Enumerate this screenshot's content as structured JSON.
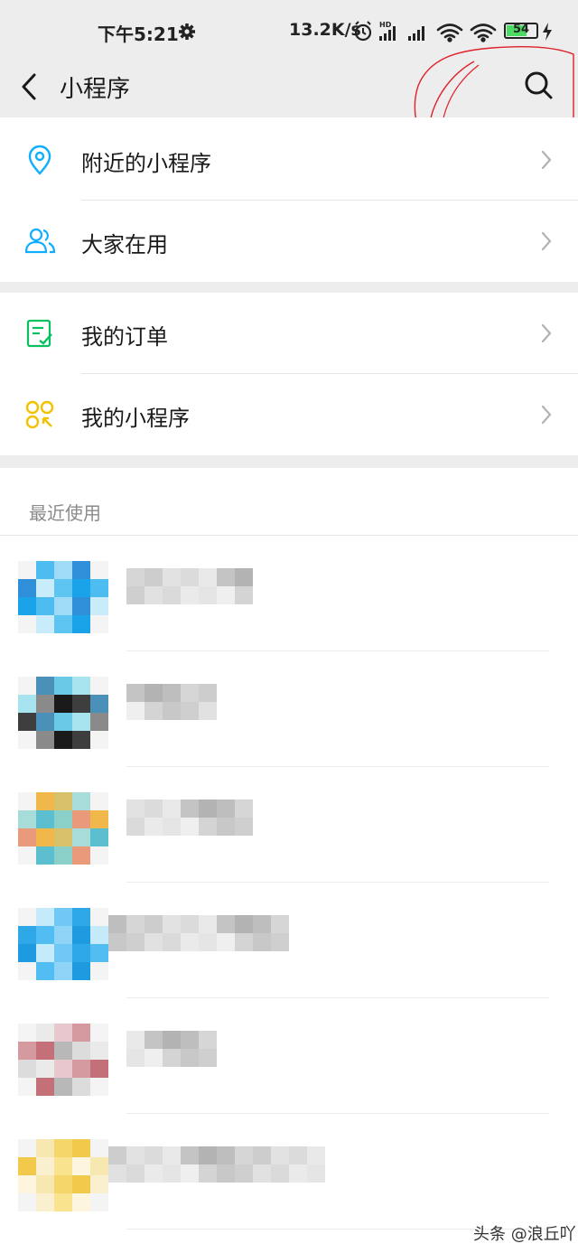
{
  "status_bar": {
    "time": "下午5:21",
    "net_speed": "13.2K/s",
    "battery_level": "54",
    "icons": [
      "gear-icon",
      "alarm-icon",
      "hd-signal-icon",
      "signal-icon",
      "wifi-icon",
      "wifi-icon",
      "battery-icon",
      "charging-icon"
    ]
  },
  "header": {
    "title": "小程序",
    "back_icon": "back-arrow-icon",
    "search_icon": "search-icon"
  },
  "menu": {
    "group1": [
      {
        "label": "附近的小程序",
        "icon": "location-pin-icon",
        "color": "#10aeff"
      },
      {
        "label": "大家在用",
        "icon": "people-icon",
        "color": "#10aeff"
      }
    ],
    "group2": [
      {
        "label": "我的订单",
        "icon": "order-list-icon",
        "color": "#07c160"
      },
      {
        "label": "我的小程序",
        "icon": "mini-programs-icon",
        "color": "#f2c200"
      }
    ]
  },
  "recent": {
    "title": "最近使用",
    "count": 6
  },
  "watermark": "头条 @浪丘吖",
  "colors": {
    "background": "#ededed",
    "annotation": "#e0202a"
  }
}
